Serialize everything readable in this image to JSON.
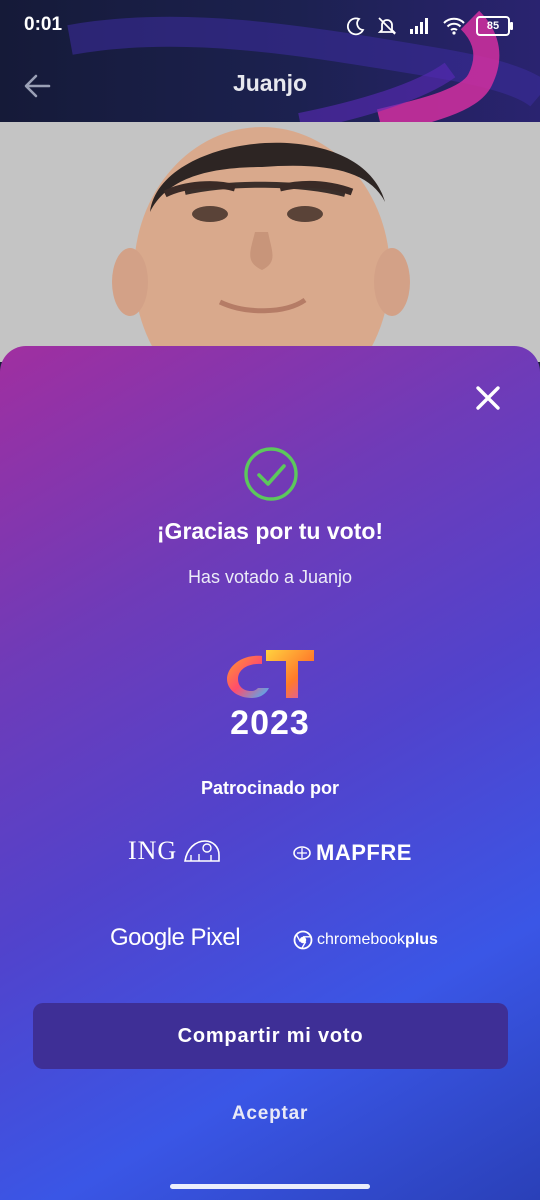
{
  "status_bar": {
    "time": "0:01",
    "battery": "85",
    "icons": [
      "moon-icon",
      "mute-icon",
      "signal-icon",
      "wifi-icon",
      "battery-icon"
    ]
  },
  "app_bar": {
    "title": "Juanjo",
    "back_icon": "arrow-left-icon"
  },
  "vote_sheet": {
    "close_icon": "close-icon",
    "success_icon": "check-circle-icon",
    "title": "¡Gracias por tu voto!",
    "subtitle": "Has votado a Juanjo",
    "logo": {
      "name": "OT",
      "year": "2023"
    },
    "sponsored_label": "Patrocinado por",
    "sponsors": [
      "ING",
      "MAPFRE",
      "Google Pixel",
      "chromebook",
      "plus"
    ],
    "share_button": "Compartir mi voto",
    "accept_button": "Aceptar"
  },
  "colors": {
    "sheet_gradient_start": "#a02fa0",
    "sheet_gradient_end": "#3a56e6",
    "check_green": "#5cc85c",
    "share_button_bg": "#3e2f96"
  }
}
